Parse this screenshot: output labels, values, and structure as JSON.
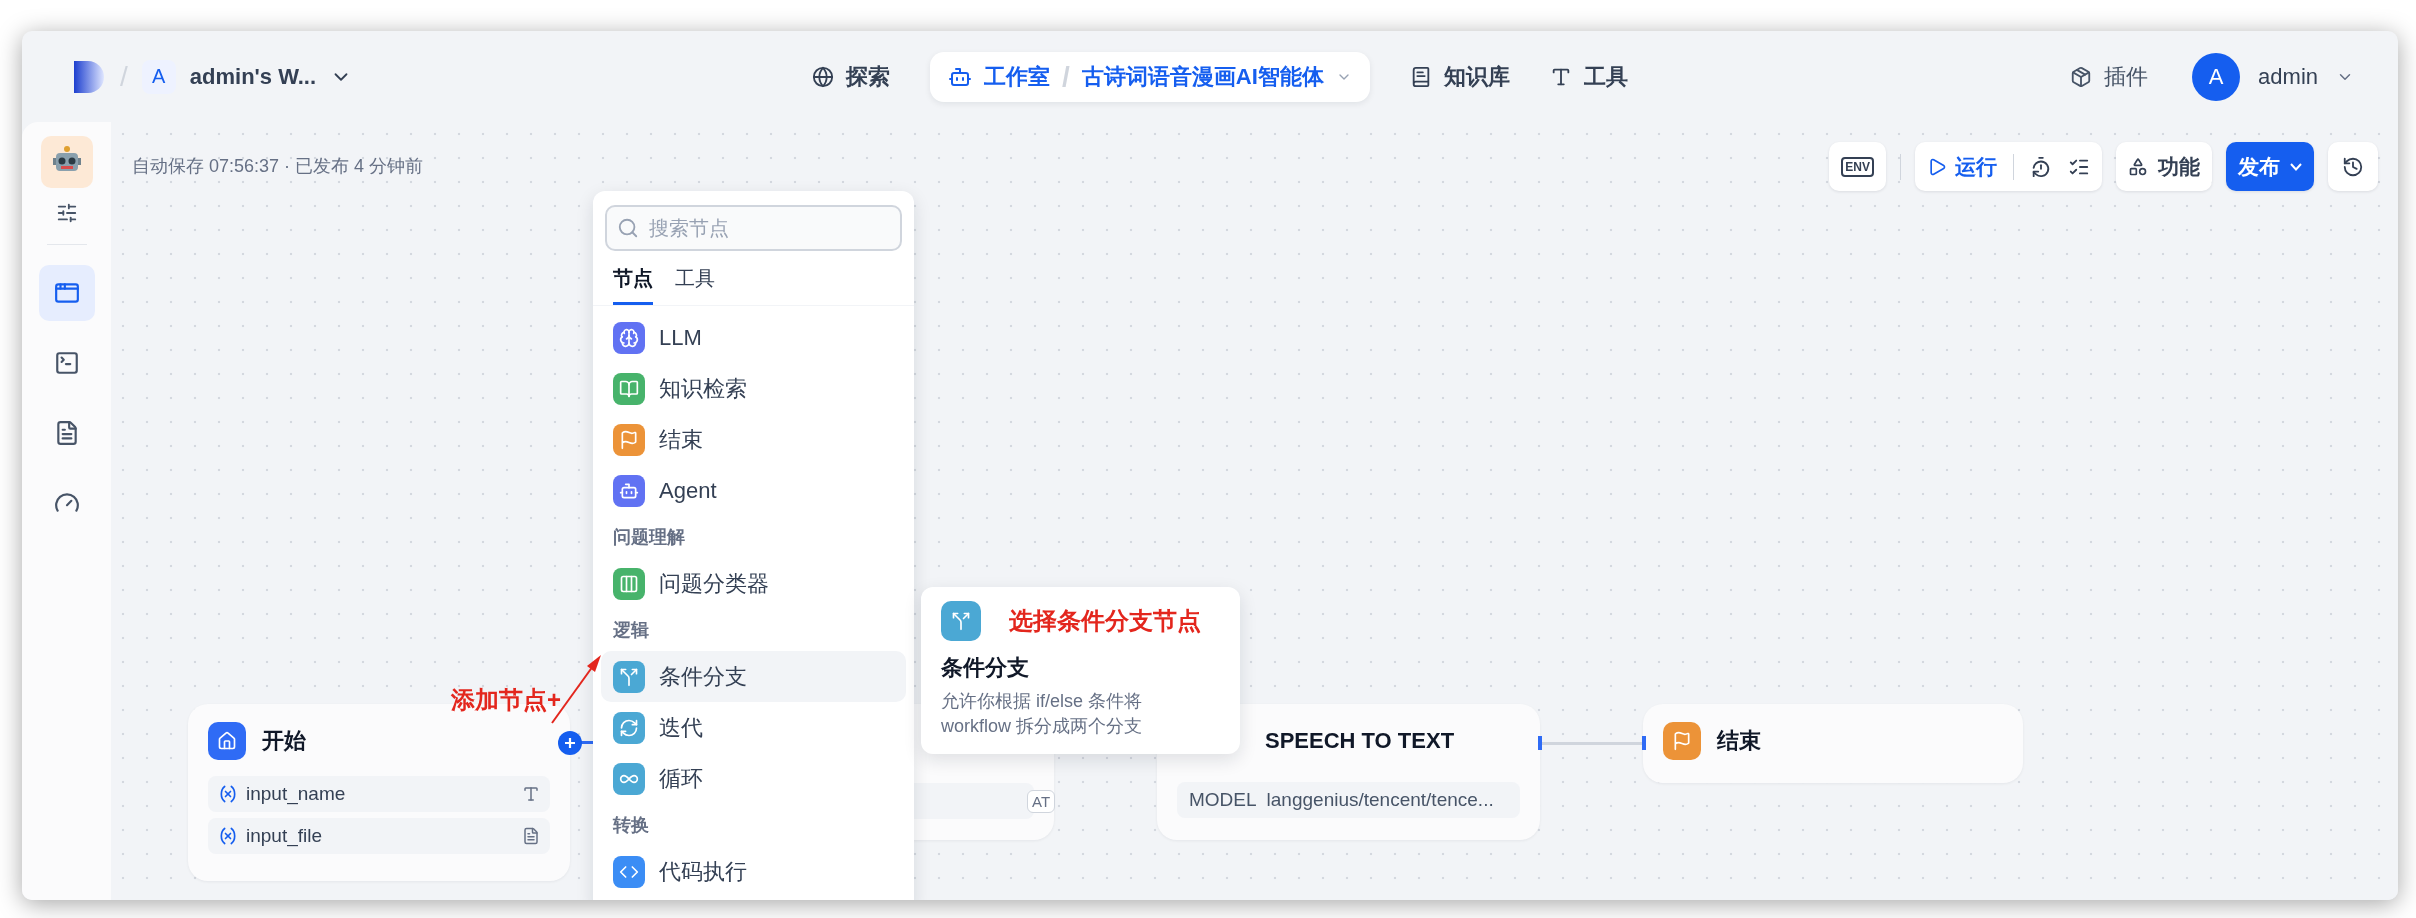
{
  "header": {
    "separator": "/",
    "workspace": {
      "initial": "A",
      "name": "admin's W..."
    },
    "nav": [
      {
        "label": "探索",
        "selected": false
      },
      {
        "label": "工作室",
        "selected": true,
        "separator": "/",
        "app": "古诗词语音漫画AI智能体"
      },
      {
        "label": "知识库",
        "selected": false
      },
      {
        "label": "工具",
        "selected": false
      }
    ],
    "plugins": "插件",
    "user": {
      "initial": "A",
      "name": "admin"
    }
  },
  "sidebar": {
    "nav": [
      {
        "selected": true
      },
      {
        "selected": false
      },
      {
        "selected": false
      },
      {
        "selected": false
      }
    ]
  },
  "canvas": {
    "autosave": "自动保存 07:56:37 · 已发布 4 分钟前",
    "toolbar": {
      "env": "ENV",
      "run": "运行",
      "features": "功能",
      "publish": "发布"
    },
    "node_menu": {
      "search": {
        "placeholder": "搜索节点"
      },
      "tabs": [
        {
          "label": "节点",
          "selected": true
        },
        {
          "label": "工具",
          "selected": false
        }
      ],
      "items": [
        {
          "kind": "node",
          "label": "LLM",
          "color": "#6172f3",
          "selected": false
        },
        {
          "kind": "node",
          "label": "知识检索",
          "color": "#47b36b",
          "selected": false
        },
        {
          "kind": "node",
          "label": "结束",
          "color": "#ec9338",
          "selected": false
        },
        {
          "kind": "node",
          "label": "Agent",
          "color": "#6172f3",
          "selected": false
        },
        {
          "kind": "heading",
          "label": "问题理解"
        },
        {
          "kind": "node",
          "label": "问题分类器",
          "color": "#47b36b",
          "selected": false
        },
        {
          "kind": "heading",
          "label": "逻辑"
        },
        {
          "kind": "node",
          "label": "条件分支",
          "color": "#4ba8d4",
          "selected": true
        },
        {
          "kind": "node",
          "label": "迭代",
          "color": "#4ba8d4",
          "selected": false
        },
        {
          "kind": "node",
          "label": "循环",
          "color": "#4ba8d4",
          "selected": false
        },
        {
          "kind": "heading",
          "label": "转换"
        },
        {
          "kind": "node",
          "label": "代码执行",
          "color": "#3b8df5",
          "selected": false
        }
      ]
    },
    "tooltip": {
      "annotation": "选择条件分支节点",
      "title": "条件分支",
      "description": "允许你根据 if/else 条件将 workflow 拆分成两个分支"
    },
    "nodes": [
      {
        "kind": "start",
        "title": "开始",
        "variables": [
          {
            "name": "input_name",
            "kind": "text"
          },
          {
            "name": "input_file",
            "kind": "file"
          }
        ]
      },
      {
        "kind": "partial",
        "tag": "AT"
      },
      {
        "kind": "speech",
        "title": "SPEECH TO TEXT",
        "model_label": "MODEL",
        "model": "langgenius/tencent/tence..."
      },
      {
        "kind": "end",
        "title": "结束"
      }
    ],
    "annotation": "添加节点+"
  }
}
